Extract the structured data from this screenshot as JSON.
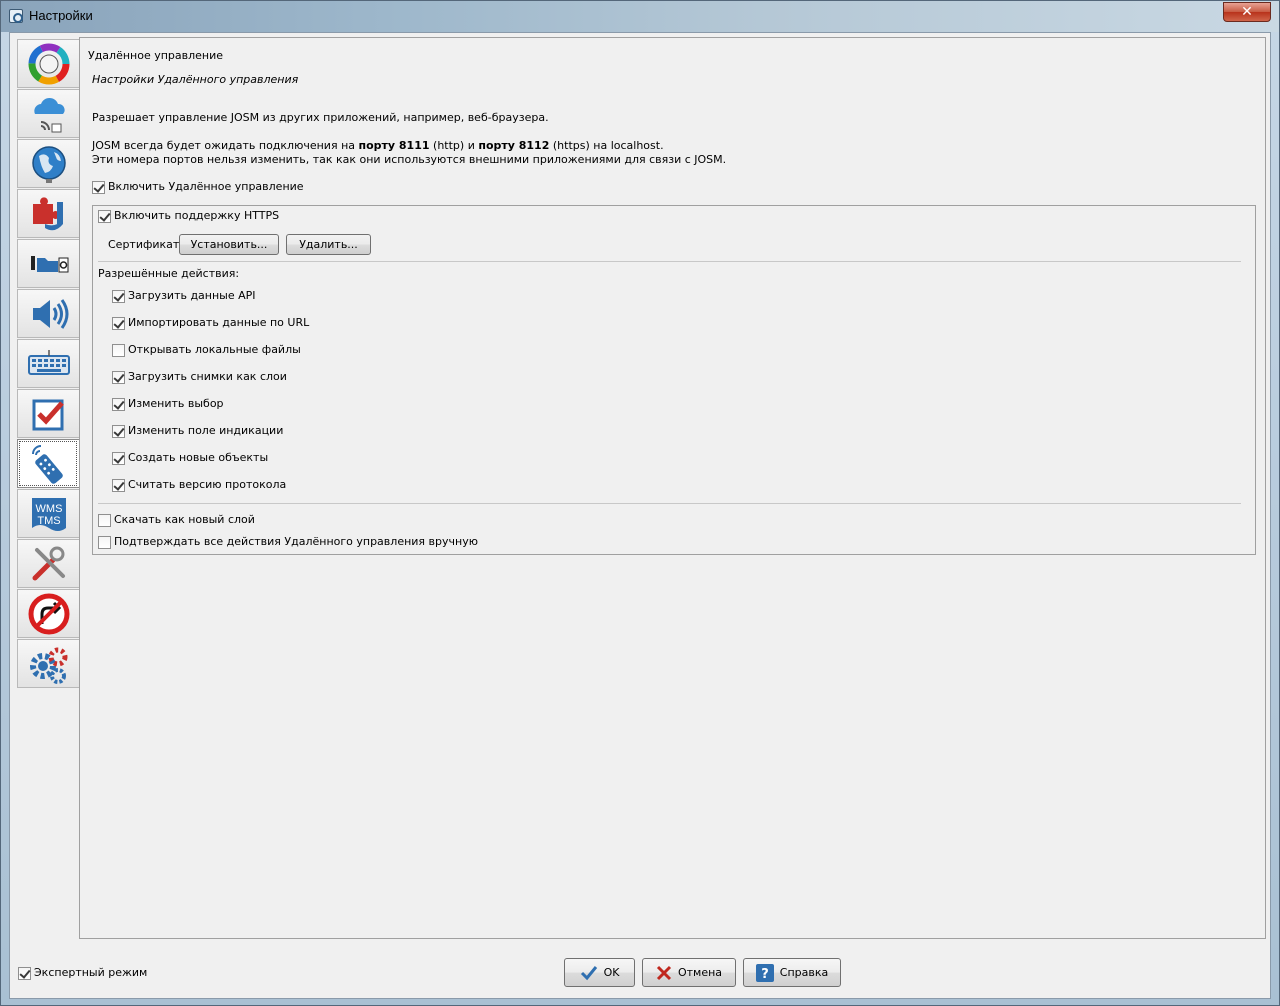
{
  "window": {
    "title": "Настройки",
    "close_symbol": "✕"
  },
  "sidebar": {
    "tabs": [
      {
        "name": "display-settings",
        "icon": "color-wheel-icon"
      },
      {
        "name": "server-settings",
        "icon": "cloud-connection-icon"
      },
      {
        "name": "projection-settings",
        "icon": "globe-icon"
      },
      {
        "name": "plugins",
        "icon": "plugin-icon"
      },
      {
        "name": "presets",
        "icon": "folder-icon"
      },
      {
        "name": "audio",
        "icon": "speaker-icon"
      },
      {
        "name": "shortcuts",
        "icon": "keyboard-icon"
      },
      {
        "name": "validator",
        "icon": "checkbox-icon"
      },
      {
        "name": "remote-control",
        "icon": "remote-control-icon",
        "active": true
      },
      {
        "name": "imagery",
        "icon": "wms-tms-icon",
        "label_top": "WMS",
        "label_bottom": "TMS"
      },
      {
        "name": "advanced",
        "icon": "tools-icon"
      },
      {
        "name": "turn-restrictions",
        "icon": "no-turn-icon"
      },
      {
        "name": "advanced-preferences",
        "icon": "gears-icon"
      }
    ]
  },
  "content": {
    "title": "Удалённое управление",
    "subtitle": "Настройки Удалённого управления",
    "description": "Разрешает управление JOSM из других приложений, например, веб-браузера.",
    "ports_text_1": "JOSM всегда будет ожидать подключения на ",
    "port_http_bold": "порту 8111",
    "ports_text_2": " (http) и ",
    "port_https_bold": "порту 8112",
    "ports_text_3": " (https) на localhost.",
    "ports_line2": "Эти номера портов нельзя изменить, так как они используются внешними приложениями для связи с JOSM.",
    "enable_remote": {
      "label": "Включить Удалённое управление",
      "checked": true
    },
    "enable_https": {
      "label": "Включить поддержку HTTPS",
      "checked": true
    },
    "certificate_label": "Сертификат:",
    "install_button": "Установить...",
    "remove_button": "Удалить...",
    "permitted_label": "Разрешённые действия:",
    "permissions": [
      {
        "label": "Загрузить данные API",
        "checked": true
      },
      {
        "label": "Импортировать данные по URL",
        "checked": true
      },
      {
        "label": "Открывать локальные файлы",
        "checked": false
      },
      {
        "label": "Загрузить снимки как слои",
        "checked": true
      },
      {
        "label": "Изменить выбор",
        "checked": true
      },
      {
        "label": "Изменить поле индикации",
        "checked": true
      },
      {
        "label": "Создать новые объекты",
        "checked": true
      },
      {
        "label": "Считать версию протокола",
        "checked": true
      }
    ],
    "download_new_layer": {
      "label": "Скачать как новый слой",
      "checked": false
    },
    "confirm_all": {
      "label": "Подтверждать все действия Удалённого управления вручную",
      "checked": false
    }
  },
  "footer": {
    "expert_mode": {
      "label": "Экспертный режим",
      "checked": true
    },
    "ok_label": "OK",
    "cancel_label": "Отмена",
    "help_label": "Справка"
  },
  "colors": {
    "accent_blue": "#2f6fb0",
    "cancel_red": "#c0281e",
    "checkbox_mark": "#3a3a3a"
  }
}
